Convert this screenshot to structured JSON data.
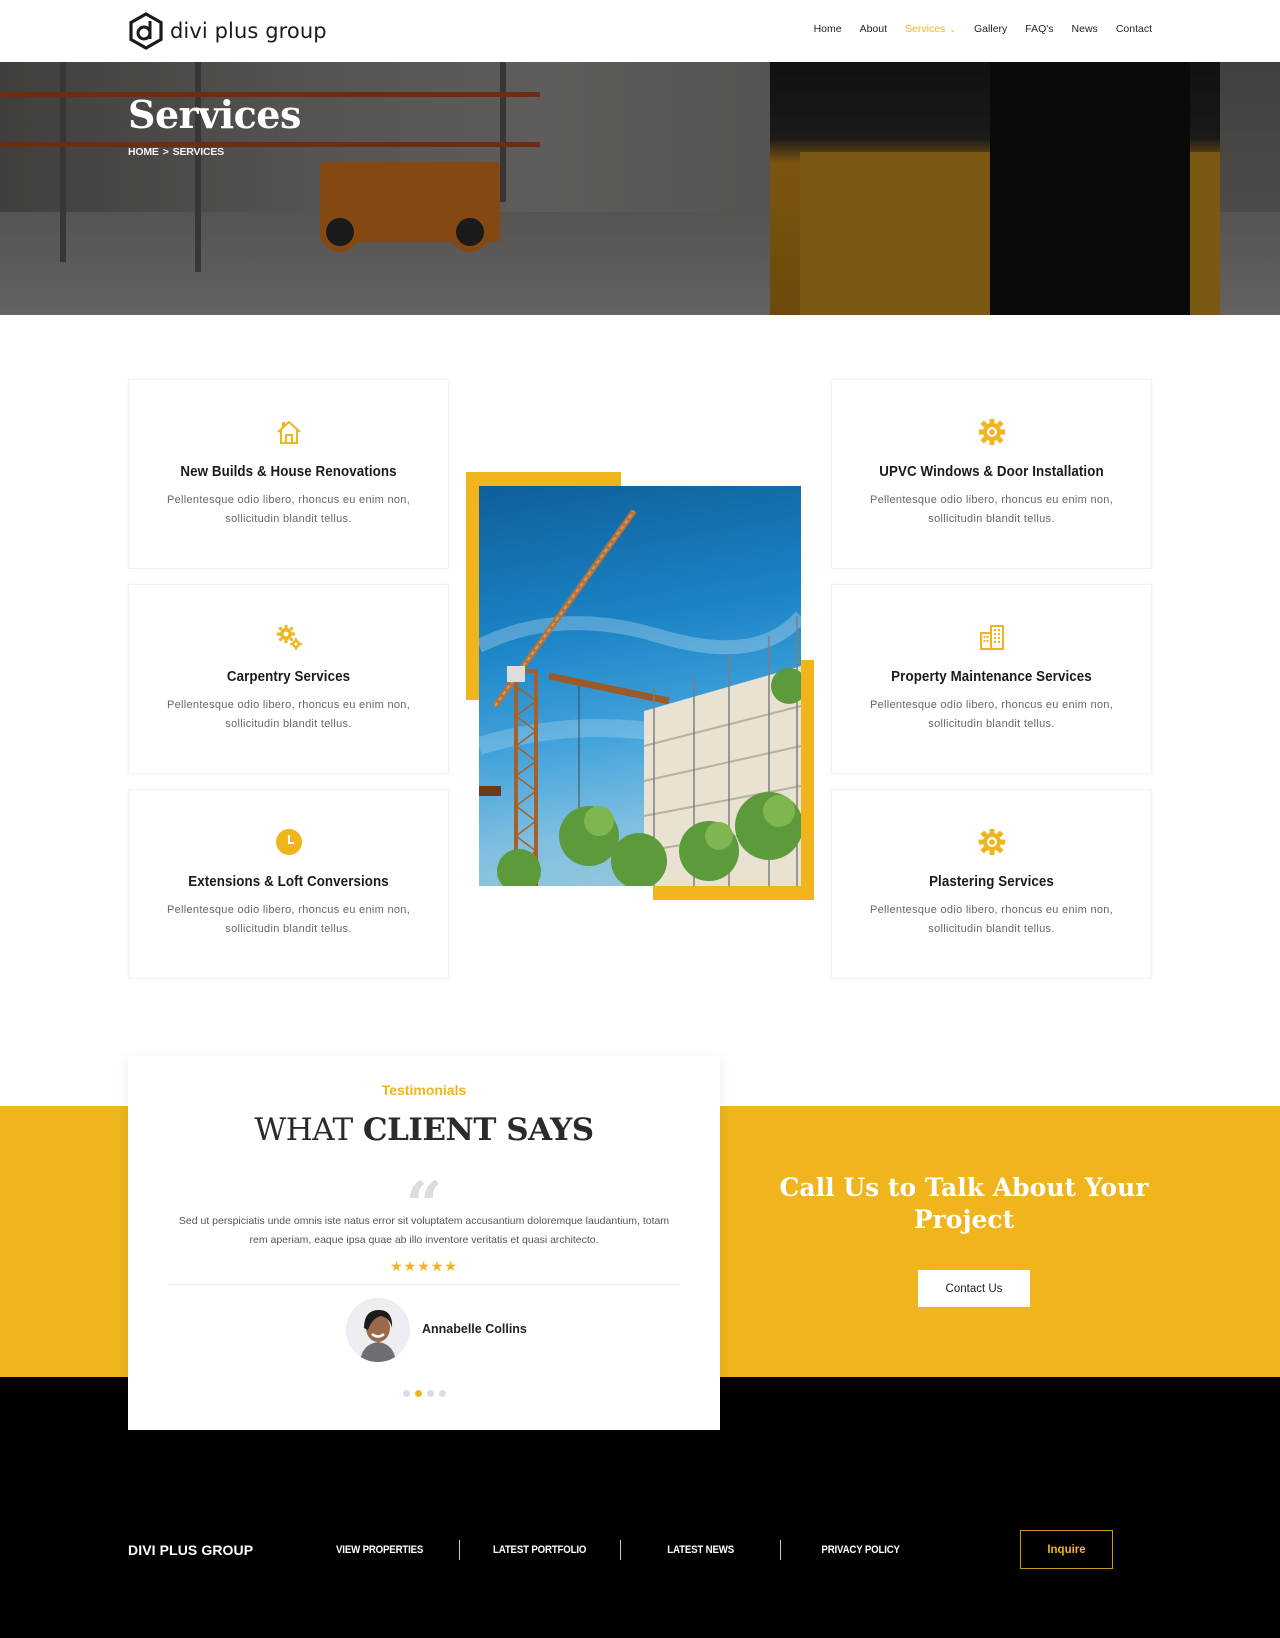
{
  "header": {
    "logo_text": "divi plus group",
    "nav": [
      {
        "label": "Home",
        "active": false
      },
      {
        "label": "About",
        "active": false
      },
      {
        "label": "Services",
        "active": true,
        "has_dropdown": true
      },
      {
        "label": "Gallery",
        "active": false
      },
      {
        "label": "FAQ's",
        "active": false
      },
      {
        "label": "News",
        "active": false
      },
      {
        "label": "Contact",
        "active": false
      }
    ],
    "dropdown_icon": "chevron-down-icon"
  },
  "hero": {
    "title": "Services",
    "breadcrumb": {
      "home": "HOME",
      "separator": ">",
      "current": "SERVICES"
    }
  },
  "services": [
    {
      "icon": "house-icon",
      "title": "New Builds & House Renovations",
      "desc": "Pellentesque odio libero, rhoncus eu enim non, sollicitudin blandit tellus."
    },
    {
      "icon": "gears-icon",
      "title": "Carpentry Services",
      "desc": "Pellentesque odio libero, rhoncus eu enim non, sollicitudin blandit tellus."
    },
    {
      "icon": "clock-icon",
      "title": "Extensions & Loft Conversions",
      "desc": "Pellentesque odio libero, rhoncus eu enim non, sollicitudin blandit tellus."
    },
    {
      "icon": "gear-icon",
      "title": "UPVC Windows & Door Installation",
      "desc": "Pellentesque odio libero, rhoncus eu enim non, sollicitudin blandit tellus."
    },
    {
      "icon": "buildings-icon",
      "title": "Property Maintenance Services",
      "desc": "Pellentesque odio libero, rhoncus eu enim non, sollicitudin blandit tellus."
    },
    {
      "icon": "gear-icon",
      "title": "Plastering Services",
      "desc": "Pellentesque odio libero, rhoncus eu enim non, sollicitudin blandit tellus."
    }
  ],
  "testimonial": {
    "kicker": "Testimonials",
    "heading_light": "WHAT",
    "heading_bold": "CLIENT SAYS",
    "quote_mark": "“",
    "text": "Sed ut perspiciatis unde omnis iste natus error sit voluptatem accusantium doloremque laudantium, totam rem aperiam, eaque ipsa quae ab illo inventore veritatis et quasi architecto.",
    "rating": 5,
    "rating_max": 5,
    "stars": "★★★★★",
    "author": "Annabelle Collins",
    "slides": 4,
    "active_slide": 2
  },
  "cta": {
    "title": "Call Us to Talk About Your Project",
    "button": "Contact Us"
  },
  "footer": {
    "brand": "DIVI PLUS GROUP",
    "links": [
      "VIEW PROPERTIES",
      "LATEST PORTFOLIO",
      "LATEST NEWS",
      "PRIVACY POLICY"
    ],
    "inquire": "Inquire"
  },
  "colors": {
    "accent": "#f0b41c",
    "text_dark": "#1a1a1a",
    "footer_bg": "#000000"
  }
}
